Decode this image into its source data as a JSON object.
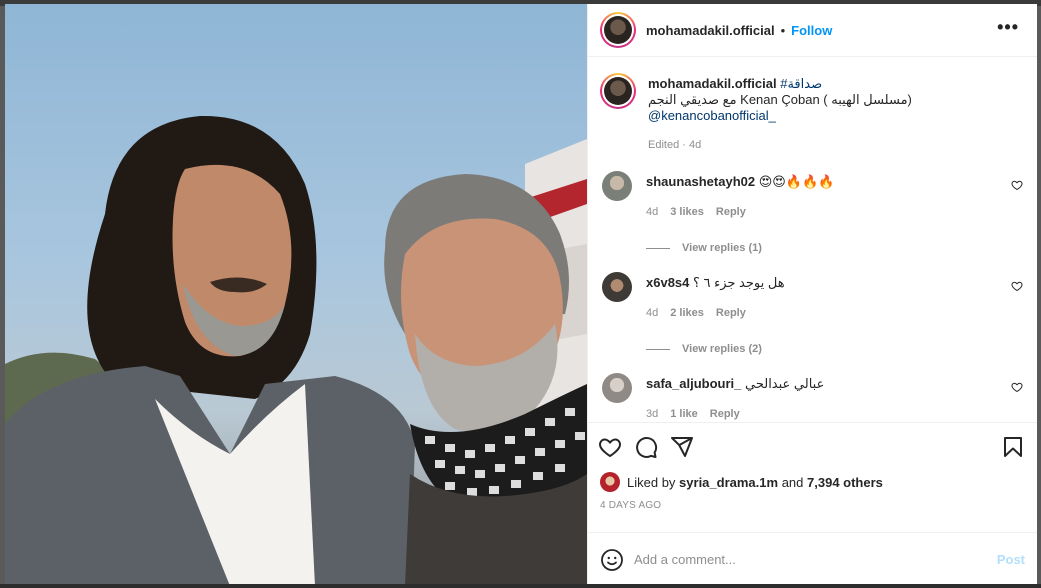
{
  "post": {
    "username": "mohamadakil.official",
    "follow_label": "Follow",
    "dot": "•",
    "more_label": "•••"
  },
  "caption": {
    "username": "mohamadakil.official",
    "hashtag": "#صداقة",
    "line2": "مع صديقي النجم Kenan Çoban ( مسلسل الهيبه)",
    "mention": "@kenancobanofficial_",
    "meta": "Edited · 4d"
  },
  "comments": [
    {
      "username": "shaunashetayh02",
      "text": "😍😍🔥🔥🔥",
      "time": "4d",
      "likes": "3 likes",
      "reply": "Reply",
      "view_replies": "View replies (1)",
      "avatar_color": "#8a8f88"
    },
    {
      "username": "x6v8s4",
      "text": "هل يوجد جزء ٦ ؟",
      "time": "4d",
      "likes": "2 likes",
      "reply": "Reply",
      "view_replies": "View replies (2)",
      "avatar_color": "#3e3a35"
    },
    {
      "username": "safa_aljubouri_",
      "text": "عبالي عبدالحي",
      "time": "3d",
      "likes": "1 like",
      "reply": "Reply",
      "avatar_color": "#b9b2ab"
    }
  ],
  "likes": {
    "prefix": "Liked by ",
    "user": "syria_drama.1m",
    "middle": " and ",
    "others": "7,394 others"
  },
  "timestamp": "4 DAYS AGO",
  "add_comment": {
    "placeholder": "Add a comment...",
    "post_label": "Post"
  },
  "icons": {
    "like": "heart-icon",
    "comment": "comment-icon",
    "share": "share-icon",
    "save": "bookmark-icon",
    "emoji": "emoji-icon"
  },
  "colors": {
    "follow": "#0095f6",
    "post_disabled": "#b2dffc",
    "hashtag": "#00376b"
  }
}
